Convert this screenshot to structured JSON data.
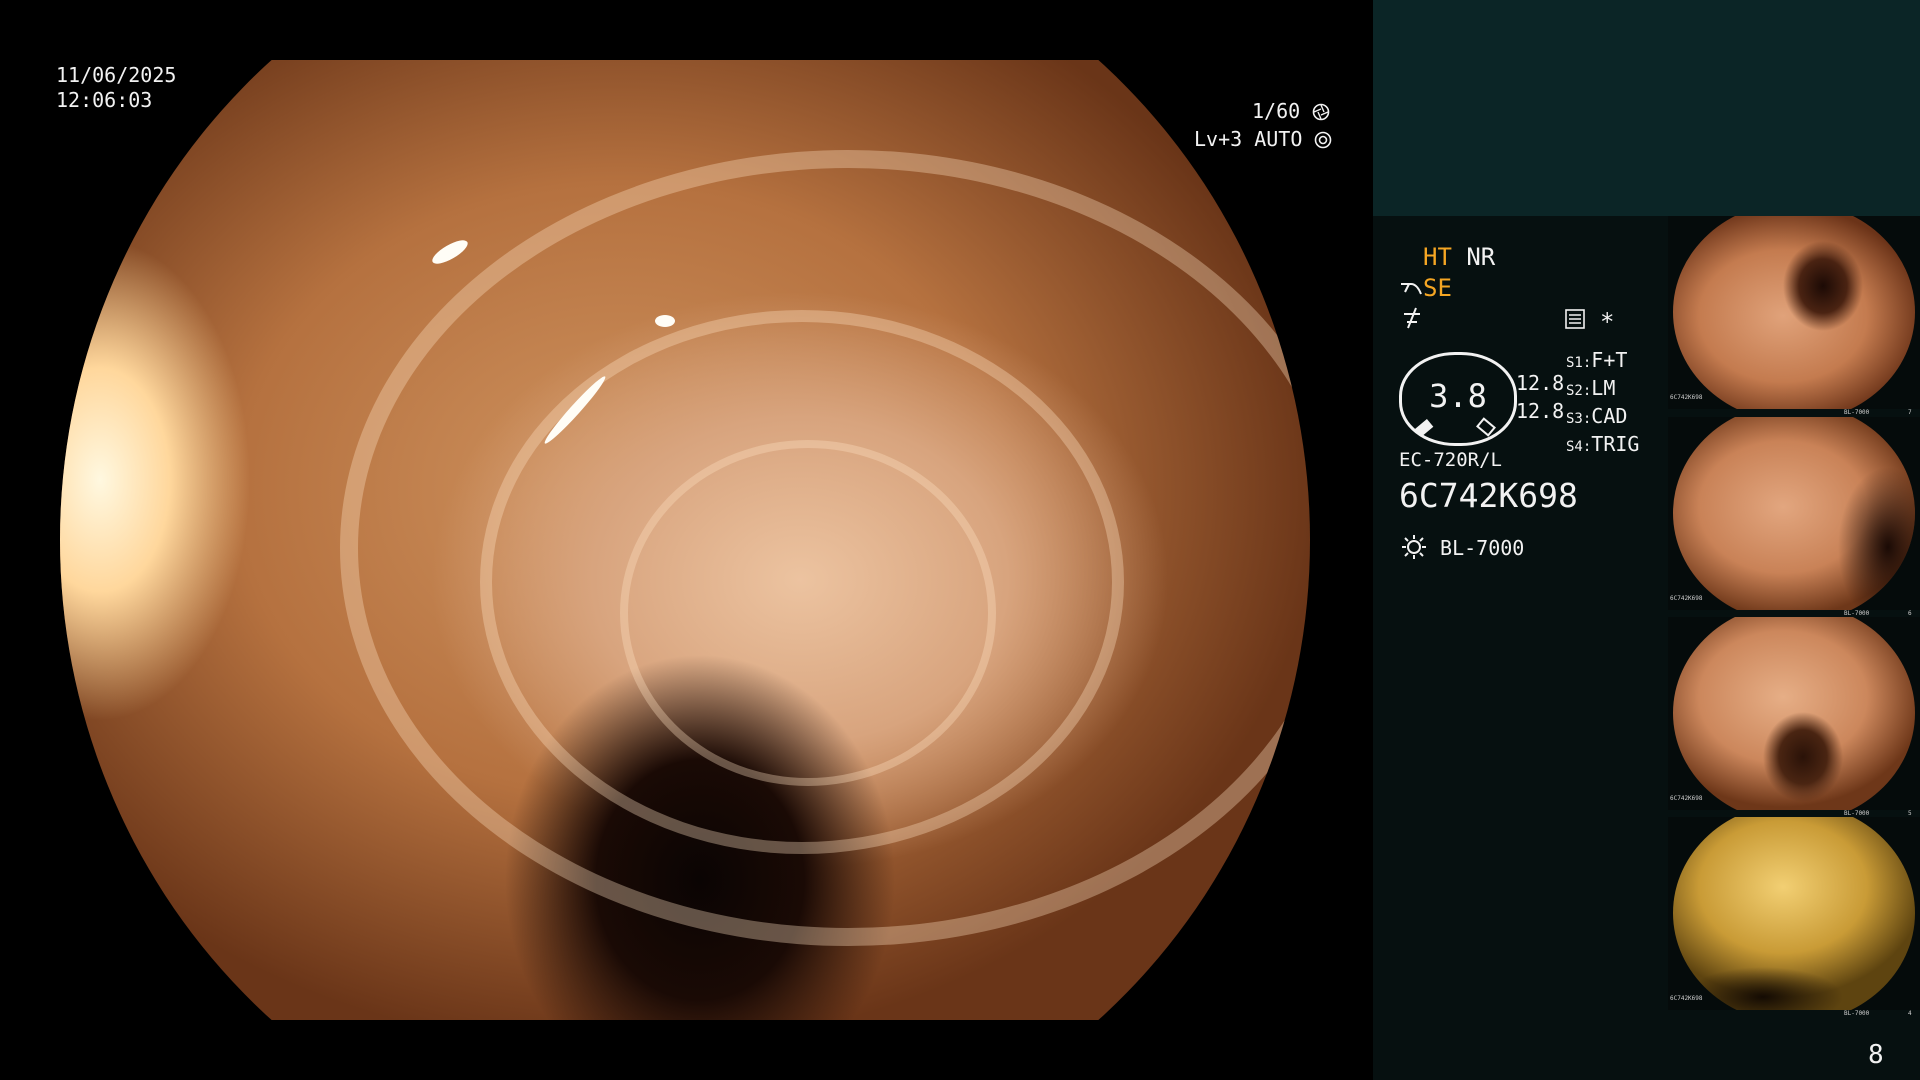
{
  "main_view": {
    "date": "11/06/2025",
    "time": "12:06:03",
    "shutter": "1/60",
    "level": "Lv+3",
    "mode": "AUTO"
  },
  "panel": {
    "ht": "HT",
    "nr": "NR",
    "se": "SE",
    "gauge_value": "3.8",
    "readout_1": "12.8",
    "readout_2": "12.8",
    "settings": [
      {
        "key": "S1:",
        "value": "F+T"
      },
      {
        "key": "S2:",
        "value": "LM"
      },
      {
        "key": "S3:",
        "value": "CAD"
      },
      {
        "key": "S4:",
        "value": "TRIG"
      }
    ],
    "scope_model": "EC-720R/L",
    "serial": "6C742K698",
    "light_source": "BL-7000",
    "asterisk": "*",
    "image_count": "8"
  },
  "thumbnails": [
    {
      "serial": "6C742K698",
      "source": "BL-7000",
      "index": "7"
    },
    {
      "serial": "6C742K698",
      "source": "BL-7000",
      "index": "6"
    },
    {
      "serial": "6C742K698",
      "source": "BL-7000",
      "index": "5"
    },
    {
      "serial": "6C742K698",
      "source": "BL-7000",
      "index": "4"
    }
  ],
  "colors": {
    "accent_orange": "#f5a623",
    "panel_dark": "#061010",
    "panel_top": "#0b2526"
  },
  "icons": [
    "shutter-icon",
    "auto-iris-icon",
    "scope-bend-icon",
    "freeze-icon",
    "memory-icon",
    "lamp-icon"
  ]
}
